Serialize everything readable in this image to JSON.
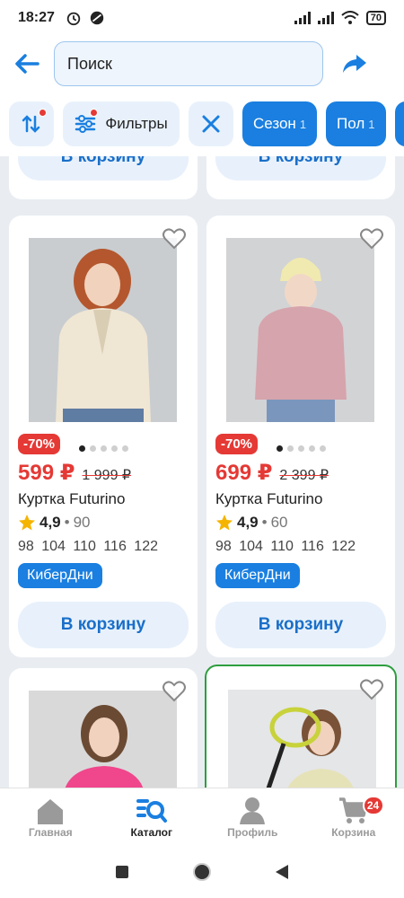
{
  "status_bar": {
    "time": "18:27",
    "battery": "70"
  },
  "header": {
    "search_placeholder": "Поиск"
  },
  "filters": {
    "filter_label": "Фильтры",
    "season_label": "Сезон",
    "season_count": "1",
    "gender_label": "Пол",
    "gender_count": "1"
  },
  "cart_label": "В корзину",
  "products": [
    {
      "discount": "-70%",
      "price": "599 ₽",
      "old_price": "1 999 ₽",
      "title": "Куртка Futurino",
      "rating": "4,9",
      "reviews": "90",
      "sizes": "98 104 110 116 122",
      "promo": "КиберДни"
    },
    {
      "discount": "-70%",
      "price": "699 ₽",
      "old_price": "2 399 ₽",
      "title": "Куртка Futurino",
      "rating": "4,9",
      "reviews": "60",
      "sizes": "98 104 110 116 122",
      "promo": "КиберДни"
    }
  ],
  "bottom_nav": {
    "home": "Главная",
    "catalog": "Каталог",
    "profile": "Профиль",
    "cart": "Корзина",
    "cart_badge": "24"
  },
  "colors": {
    "accent": "#1a7fe0",
    "sale": "#e53935",
    "highlight_border": "#2e9e3e"
  }
}
